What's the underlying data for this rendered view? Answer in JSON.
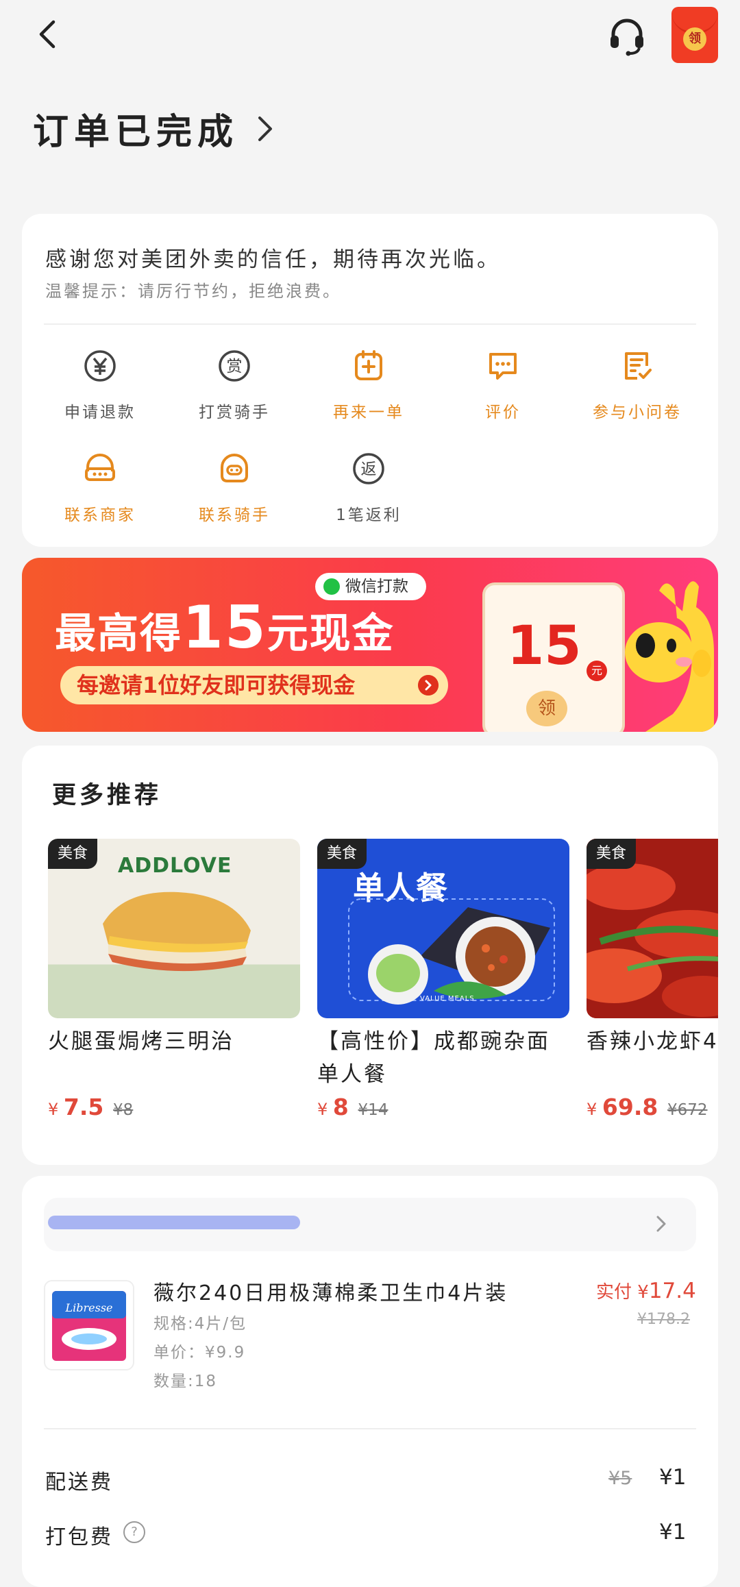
{
  "header": {
    "title": "订单已完成",
    "redpacket_label": "领"
  },
  "notice": {
    "thanks": "感谢您对美团外卖的信任，期待再次光临。",
    "tip": "温馨提示：请厉行节约，拒绝浪费。"
  },
  "actions": [
    {
      "label": "申请退款",
      "icon": "refund-yen-icon",
      "color": "gray"
    },
    {
      "label": "打赏骑手",
      "icon": "reward-icon",
      "color": "gray",
      "glyph": "赏"
    },
    {
      "label": "再来一单",
      "icon": "reorder-icon",
      "color": "orange"
    },
    {
      "label": "评价",
      "icon": "review-chat-icon",
      "color": "orange"
    },
    {
      "label": "参与小问卷",
      "icon": "survey-icon",
      "color": "orange"
    },
    {
      "label": "联系商家",
      "icon": "contact-merchant-icon",
      "color": "orange"
    },
    {
      "label": "联系骑手",
      "icon": "contact-rider-icon",
      "color": "orange"
    },
    {
      "label": "1笔返利",
      "icon": "rebate-icon",
      "color": "gray",
      "glyph": "返"
    }
  ],
  "banner": {
    "wechat_label": "微信打款",
    "headline_prefix": "最高得",
    "headline_amount": "15",
    "headline_suffix": "元现金",
    "subline": "每邀请1位好友即可获得现金",
    "envelope_amount": "15",
    "envelope_unit": "元",
    "envelope_seal": "领"
  },
  "recommend": {
    "title": "更多推荐",
    "items": [
      {
        "tag": "美食",
        "name": "火腿蛋焗烤三明治",
        "currency": "¥",
        "price": "7.5",
        "original": "¥8",
        "brand": "ADDLOVE"
      },
      {
        "tag": "美食",
        "name": "【高性价】成都豌杂面单人餐",
        "currency": "¥",
        "price": "8",
        "original": "¥14",
        "img_title": "单人餐",
        "img_caption": "VALUE MEALS"
      },
      {
        "tag": "美食",
        "name": "香辣小龙虾4",
        "currency": "¥",
        "price": "69.8",
        "original": "¥672"
      }
    ]
  },
  "order": {
    "product_name": "薇尔240日用极薄棉柔卫生巾4片装",
    "spec": "规格:4片/包",
    "unit_price": "单价：¥9.9",
    "quantity": "数量:18",
    "paid_label": "实付",
    "paid_currency": "¥",
    "paid_value": "17.4",
    "original_total": "¥178.2",
    "package_brand": "Libresse"
  },
  "fees": [
    {
      "label": "配送费",
      "old": "¥5",
      "value": "¥1"
    },
    {
      "label": "打包费",
      "old": "",
      "value": "¥1",
      "has_help": true
    }
  ]
}
